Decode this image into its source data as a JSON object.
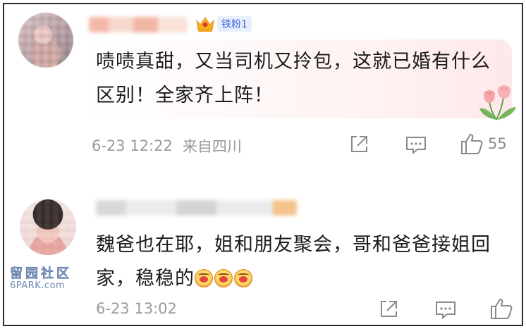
{
  "comments": [
    {
      "badge": {
        "crown_icon": "crown-icon",
        "label": "铁粉1"
      },
      "text": "啧啧真甜，又当司机又拎包，这就已婚有什么区别！全家齐上阵！",
      "date": "6-23 12:22",
      "location": "来自四川",
      "likes": "55"
    },
    {
      "text": "魏爸也在耶，姐和朋友聚会，哥和爸爸接姐回家，稳稳的",
      "emoji_count": 3,
      "emoji_icon": "heart-eyes-emoji-icon",
      "date": "6-23 13:02"
    }
  ],
  "watermark": {
    "line1": "留园社区",
    "line2": "6PARK.com"
  },
  "colors": {
    "text": "#1b1b1b",
    "meta": "#9a9a9a",
    "badge_bg": "#e8eefb",
    "badge_text": "#3c66d8"
  }
}
